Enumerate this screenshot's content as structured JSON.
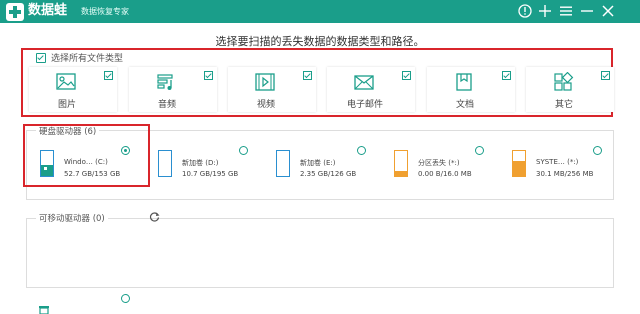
{
  "app": {
    "brand": "数据蛙",
    "subtitle": "数据恢复专家"
  },
  "window_controls": [
    "help-icon",
    "plus-icon",
    "menu-icon",
    "minimize-icon",
    "close-icon"
  ],
  "heading": "选择要扫描的丢失数据的数据类型和路径。",
  "select_all": {
    "label": "选择所有文件类型",
    "checked": true
  },
  "file_types": [
    {
      "label": "图片",
      "icon": "image-icon",
      "checked": true
    },
    {
      "label": "音频",
      "icon": "audio-icon",
      "checked": true
    },
    {
      "label": "视频",
      "icon": "video-icon",
      "checked": true
    },
    {
      "label": "电子邮件",
      "icon": "email-icon",
      "checked": true
    },
    {
      "label": "文档",
      "icon": "document-icon",
      "checked": true
    },
    {
      "label": "其它",
      "icon": "other-icon",
      "checked": true
    }
  ],
  "hard_drives": {
    "title": "硬盘驱动器 (6)",
    "items": [
      {
        "name": "Windo… (C:)",
        "size": "52.7 GB/153 GB",
        "selected": true,
        "icon": "system-drive-icon"
      },
      {
        "name": "新加卷 (D:)",
        "size": "10.7 GB/195 GB",
        "selected": false,
        "icon": "drive-icon"
      },
      {
        "name": "新加卷 (E:)",
        "size": "2.35 GB/126 GB",
        "selected": false,
        "icon": "drive-icon"
      },
      {
        "name": "分区丢失 (*:)",
        "size": "0.00 B/16.0 MB",
        "selected": false,
        "icon": "lost-partition-icon"
      },
      {
        "name": "SYSTE… (*:)",
        "size": "30.1 MB/256 MB",
        "selected": false,
        "icon": "lost-partition-icon"
      }
    ]
  },
  "removable": {
    "title": "可移动驱动器 (0)"
  },
  "colors": {
    "accent": "#1a9e8a",
    "highlight": "#d9252b",
    "drive_blue": "#2a8fd0",
    "drive_orange": "#f0a030"
  }
}
